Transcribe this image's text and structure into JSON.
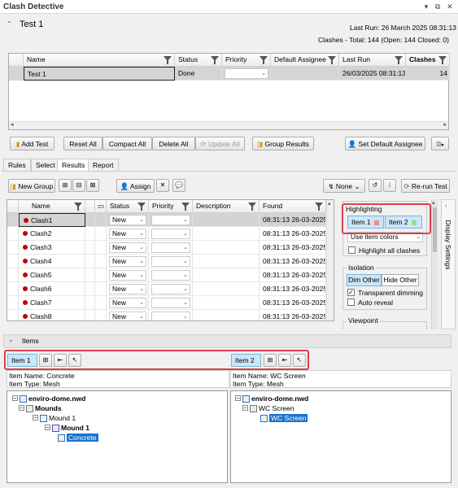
{
  "window": {
    "title": "Clash Detective"
  },
  "test_header": {
    "name": "Test 1",
    "last_run": "Last Run:  26 March 2025 08:31:13",
    "summary": "Clashes -  Total:  144  (Open:  144  Closed:  0)"
  },
  "tests_table": {
    "headers": [
      "Name",
      "Status",
      "Priority",
      "Default Assignee",
      "Last Run",
      "Clashes"
    ],
    "row": {
      "name": "Test 1",
      "status": "Done",
      "last_run": "26/03/2025 08:31:13",
      "clashes": "14"
    }
  },
  "test_buttons": {
    "add_test": "Add Test",
    "reset_all": "Reset All",
    "compact_all": "Compact All",
    "delete_all": "Delete All",
    "update_all": "Update All",
    "group_results": "Group Results",
    "set_default_assignee": "Set Default Assignee"
  },
  "tabs": [
    "Rules",
    "Select",
    "Results",
    "Report"
  ],
  "results_toolbar": {
    "new_group": "New Group",
    "assign": "Assign",
    "none": "None",
    "rerun": "Re-run Test"
  },
  "results_table": {
    "headers": [
      "Name",
      "Status",
      "Priority",
      "Description",
      "Found"
    ],
    "rows": [
      {
        "name": "Clash1",
        "status": "New",
        "found": "08:31:13 26-03-2025"
      },
      {
        "name": "Clash2",
        "status": "New",
        "found": "08:31:13 26-03-2025"
      },
      {
        "name": "Clash3",
        "status": "New",
        "found": "08:31:13 26-03-2025"
      },
      {
        "name": "Clash4",
        "status": "New",
        "found": "08:31:13 26-03-2025"
      },
      {
        "name": "Clash5",
        "status": "New",
        "found": "08:31:13 26-03-2025"
      },
      {
        "name": "Clash6",
        "status": "New",
        "found": "08:31:13 26-03-2025"
      },
      {
        "name": "Clash7",
        "status": "New",
        "found": "08:31:13 26-03-2025"
      },
      {
        "name": "Clash8",
        "status": "New",
        "found": "08:31:13 26-03-2025"
      }
    ]
  },
  "display_panel": {
    "highlighting": "Highlighting",
    "item1": "Item 1",
    "item2": "Item 2",
    "item_colors": "Use item colors",
    "highlight_all": "Highlight all clashes",
    "isolation": "Isolation",
    "dim_other": "Dim Other",
    "hide_other": "Hide Other",
    "transparent_dimming": "Transparent dimming",
    "auto_reveal": "Auto reveal",
    "viewpoint": "Viewpoint",
    "side_tab": "Display Settings"
  },
  "items_section": {
    "title": "Items",
    "item1": {
      "label": "Item 1",
      "name": "Item Name: Concrete",
      "type": "Item Type: Mesh"
    },
    "item2": {
      "label": "Item 2",
      "name": "Item Name: WC Screen",
      "type": "Item Type: Mesh"
    }
  },
  "tree_left": [
    "enviro-dome.nwd",
    "Mounds",
    "Mound 1",
    "Mound 1",
    "Concrete"
  ],
  "tree_right": [
    "enviro-dome.nwd",
    "WC Screen",
    "WC Screen"
  ],
  "colors": {
    "item1": "#f08a8a",
    "item2": "#8ee08e",
    "highlight_red": "#d9414b",
    "selection_blue": "#1874cd",
    "clash_dot": "#c00000"
  }
}
